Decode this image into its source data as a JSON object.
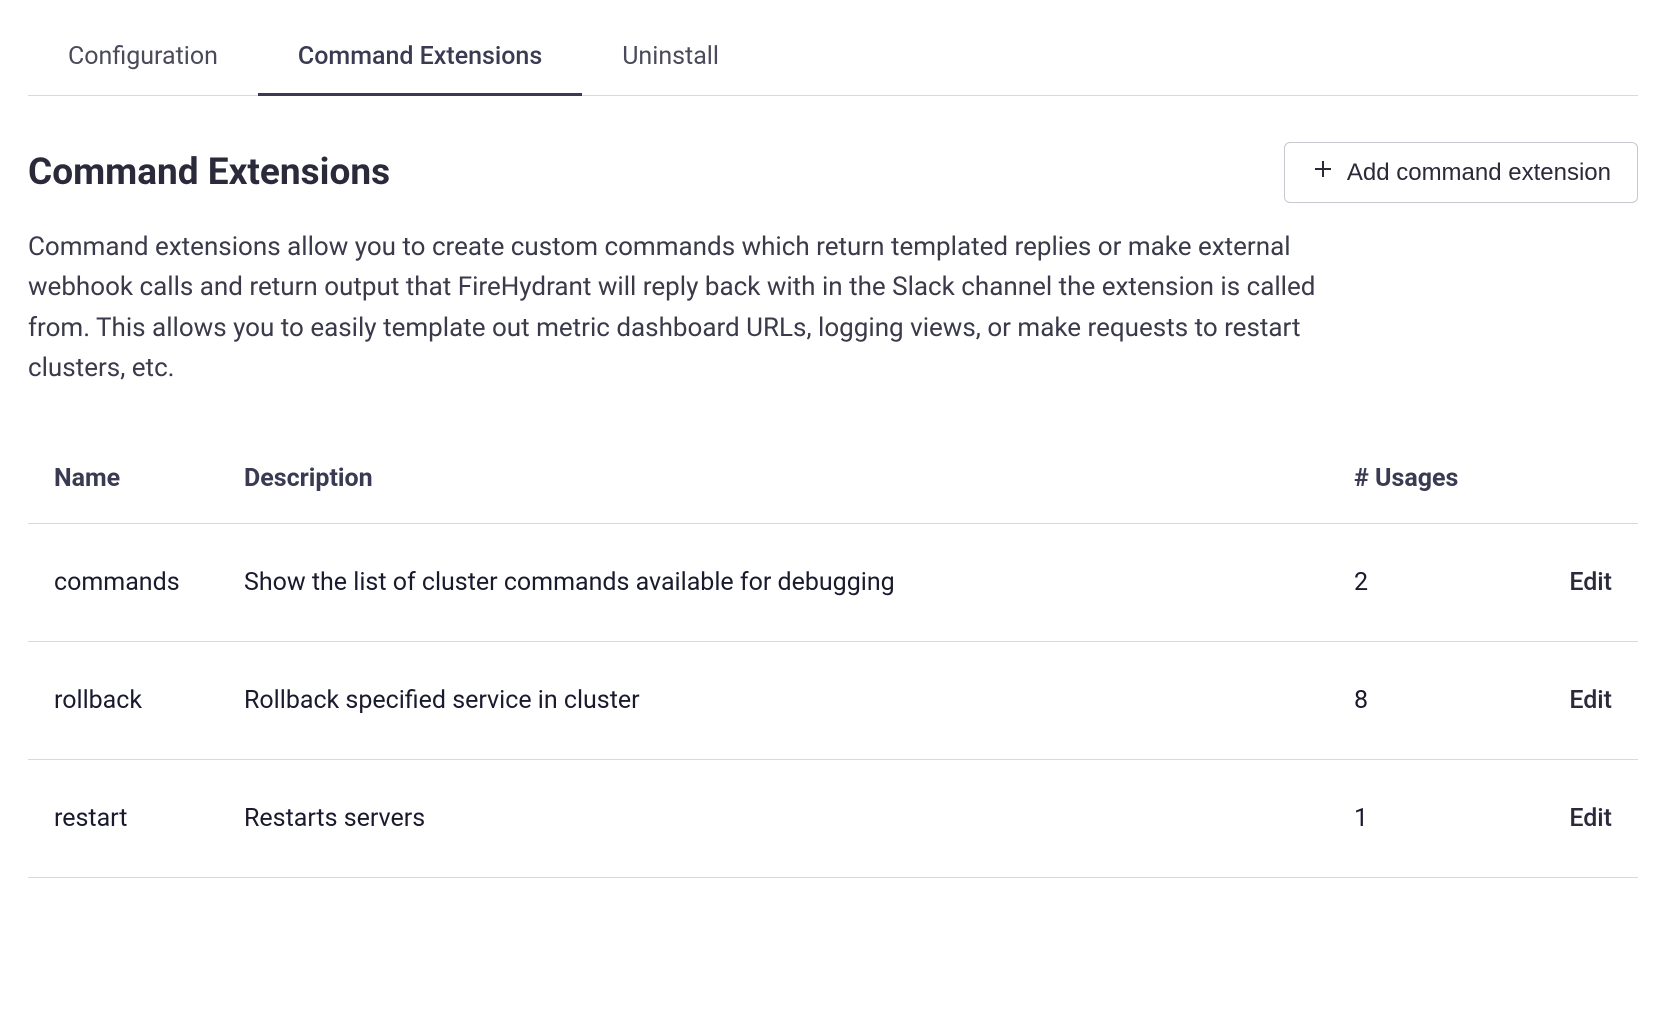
{
  "tabs": [
    {
      "label": "Configuration",
      "active": false
    },
    {
      "label": "Command Extensions",
      "active": true
    },
    {
      "label": "Uninstall",
      "active": false
    }
  ],
  "page": {
    "title": "Command Extensions",
    "description": "Command extensions allow you to create custom commands which return templated replies or make external webhook calls and return output that FireHydrant will reply back with in the Slack channel the extension is called from. This allows you to easily template out metric dashboard URLs, logging views, or make requests to restart clusters, etc."
  },
  "add_button": {
    "label": "Add command extension"
  },
  "table": {
    "headers": {
      "name": "Name",
      "description": "Description",
      "usages": "# Usages",
      "action": ""
    },
    "action_label": "Edit",
    "rows": [
      {
        "name": "commands",
        "description": "Show the list of cluster commands available for debugging",
        "usages": "2"
      },
      {
        "name": "rollback",
        "description": "Rollback specified service in cluster",
        "usages": "8"
      },
      {
        "name": "restart",
        "description": "Restarts servers",
        "usages": "1"
      }
    ]
  }
}
